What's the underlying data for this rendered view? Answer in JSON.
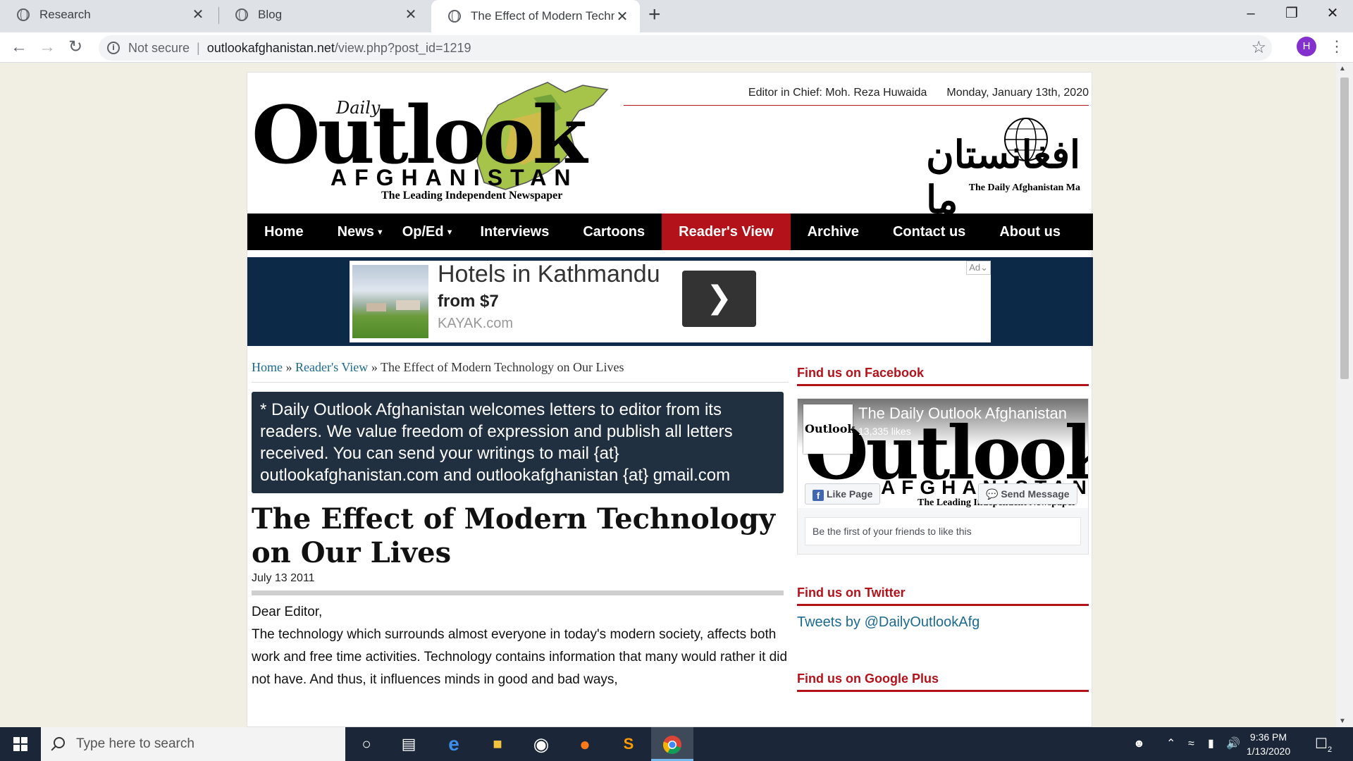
{
  "browser": {
    "tabs": [
      {
        "title": "Research"
      },
      {
        "title": "Blog"
      },
      {
        "title": "The Effect of Modern Technology"
      }
    ],
    "security_label": "Not secure",
    "url_host": "outlookafghanistan.net",
    "url_path": "/view.php?post_id=1219",
    "profile_initial": "H"
  },
  "header": {
    "logo_daily": "Daily",
    "logo_outlook": "Outlook",
    "logo_afghanistan": "AFGHANISTAN",
    "logo_tagline": "The Leading Independent Newspaper",
    "editor": "Editor in Chief: Moh. Reza Huwaida",
    "date": "Monday, January 13th, 2020",
    "dari_logo_script": "افغانستان ما",
    "dari_logo_sub": "The Daily Afghanistan Ma"
  },
  "nav": {
    "home": "Home",
    "news": "News",
    "oped": "Op/Ed",
    "interviews": "Interviews",
    "cartoons": "Cartoons",
    "readers_view": "Reader's View",
    "archive": "Archive",
    "contact": "Contact us",
    "about": "About us"
  },
  "ad": {
    "title": "Hotels in Kathmandu",
    "price": "from $7",
    "site": "KAYAK.com",
    "badge": "Ad"
  },
  "breadcrumb": {
    "home": "Home",
    "section": "Reader's View",
    "current": "The Effect of Modern Technology on Our Lives",
    "sep": "»"
  },
  "notice": "* Daily Outlook Afghanistan welcomes letters to editor from its readers. We value freedom of expression and publish all letters received. You can send your writings to mail {at} outlookafghanistan.com and outlookafghanistan {at} gmail.com",
  "article": {
    "title": "The Effect of Modern Technology on Our Lives",
    "date": "July 13 2011",
    "salutation": "Dear Editor,",
    "body": "The technology which surrounds almost everyone in today's modern society, affects both work and free time activities. Technology contains information that many would rather it did not have. And thus, it influences minds in good and bad ways,"
  },
  "sidebar": {
    "facebook_heading": "Find us on Facebook",
    "fb_page_name": "The Daily Outlook Afghanistan",
    "fb_likes": "13,335 likes",
    "fb_like_button": "Like Page",
    "fb_message_button": "Send Message",
    "fb_friends": "Be the first of your friends to like this",
    "twitter_heading": "Find us on Twitter",
    "twitter_link": "Tweets by @DailyOutlookAfg",
    "gplus_heading": "Find us on Google Plus"
  },
  "taskbar": {
    "search_placeholder": "Type here to search",
    "time": "9:36 PM",
    "date": "1/13/2020",
    "notification_count": "2"
  },
  "colors": {
    "brand_red": "#b4121b",
    "nav_black": "#000000",
    "ad_band": "#0d2948",
    "notice_bg": "#203040",
    "link_blue": "#1b6a8f"
  }
}
